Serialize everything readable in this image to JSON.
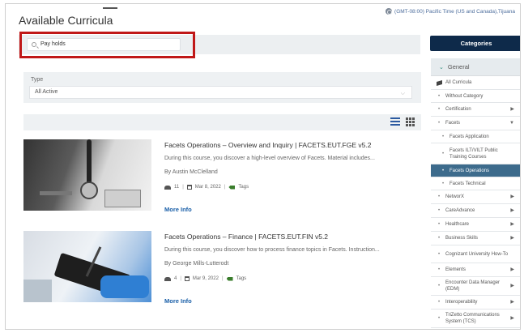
{
  "header": {
    "title": "Available Curricula",
    "timezone": "(GMT-08:00) Pacific Time (US and Canada),Tijuana"
  },
  "search": {
    "value": "Pay holds"
  },
  "filter": {
    "type_label": "Type",
    "type_value": "All Active"
  },
  "courses": [
    {
      "title": "Facets Operations – Overview and Inquiry | FACETS.EUT.FGE v5.2",
      "description": "During this course, you discover a high-level overview of Facets. Material includes...",
      "author": "By Austin McClelland",
      "users": "11",
      "date": "Mar 8, 2022",
      "tags": "Tags",
      "more": "More Info"
    },
    {
      "title": "Facets Operations – Finance | FACETS.EUT.FIN v5.2",
      "description": "During this course, you discover how to process finance topics in Facets. Instruction...",
      "author": "By George Mills-Lutterodt",
      "users": "4",
      "date": "Mar 9, 2022",
      "tags": "Tags",
      "more": "More Info"
    }
  ],
  "sidebar": {
    "categories_button": "Categories",
    "group": "General",
    "items": [
      {
        "label": "All Curricula",
        "level": 0,
        "icon": "book-icon",
        "caret": ""
      },
      {
        "label": "Without Category",
        "level": 0,
        "caret": ""
      },
      {
        "label": "Certification",
        "level": 0,
        "caret": "right"
      },
      {
        "label": "Facets",
        "level": 0,
        "caret": "down"
      },
      {
        "label": "Facets Application",
        "level": 1,
        "caret": ""
      },
      {
        "label": "Facets ILT/VILT Public Training Courses",
        "level": 1,
        "caret": ""
      },
      {
        "label": "Facets Operations",
        "level": 1,
        "caret": "",
        "active": true
      },
      {
        "label": "Facets Technical",
        "level": 1,
        "caret": ""
      },
      {
        "label": "NetworX",
        "level": 0,
        "caret": "right"
      },
      {
        "label": "CareAdvance",
        "level": 0,
        "caret": "right"
      },
      {
        "label": "Healthcare",
        "level": 0,
        "caret": "right"
      },
      {
        "label": "Business Skills",
        "level": 0,
        "caret": "right"
      },
      {
        "label": "Cognizant University How-To",
        "level": 0,
        "caret": ""
      },
      {
        "label": "Elements",
        "level": 0,
        "caret": "right"
      },
      {
        "label": "Encounter Data Manager (EDM)",
        "level": 0,
        "caret": "right"
      },
      {
        "label": "Interoperability",
        "level": 0,
        "caret": "right"
      },
      {
        "label": "TriZetto Communications System (TCS)",
        "level": 0,
        "caret": "right"
      }
    ]
  },
  "colors": {
    "accent_dark": "#0e2a4a",
    "active_item": "#3d6b8c",
    "link": "#1a5fa8",
    "highlight": "#c01818"
  }
}
